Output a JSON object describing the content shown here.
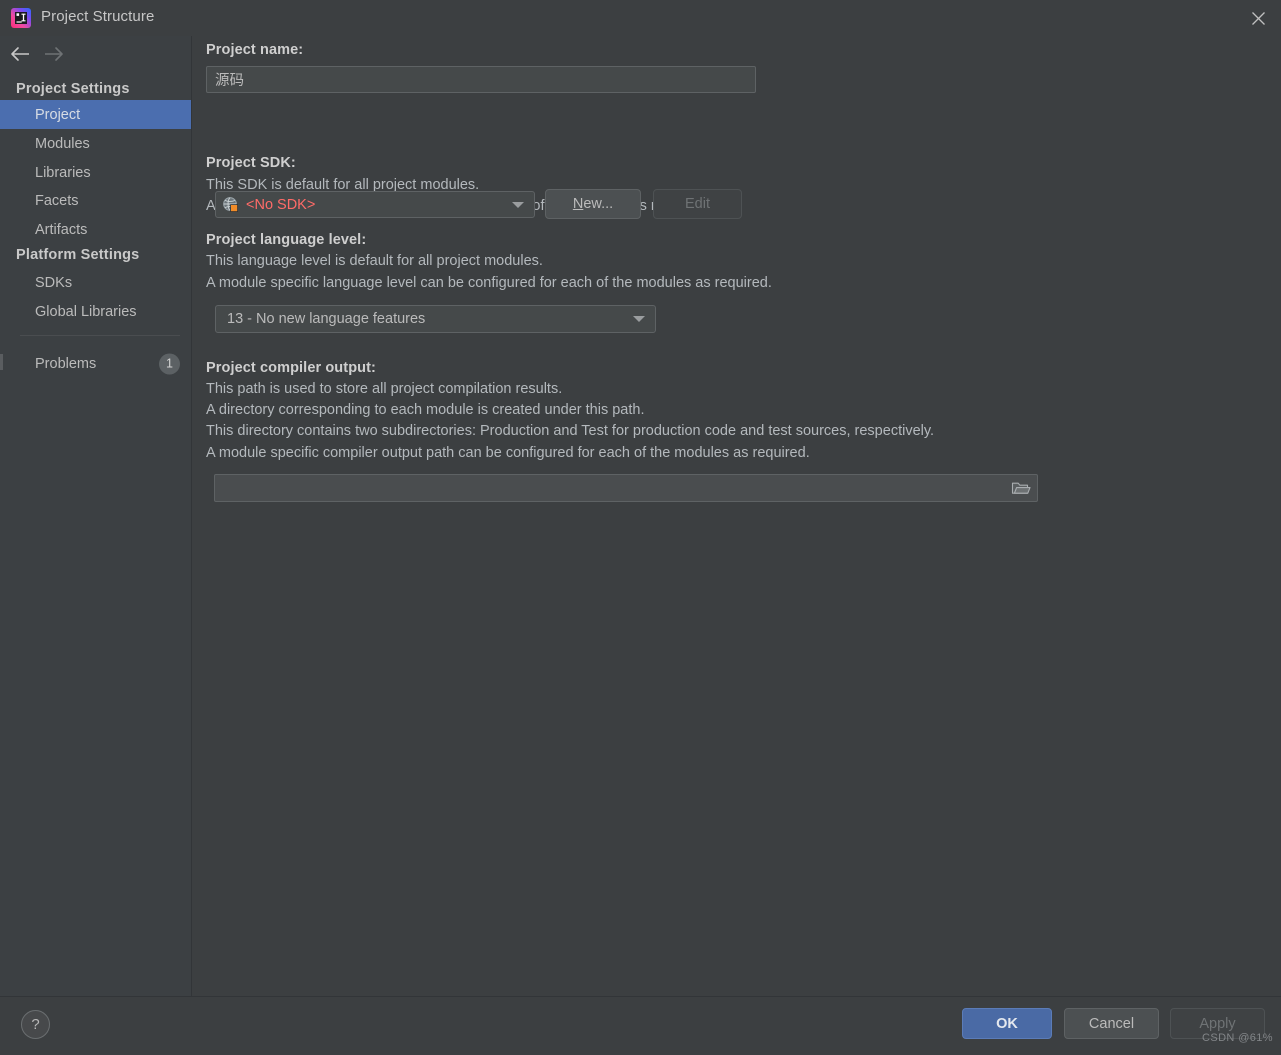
{
  "window": {
    "title": "Project Structure",
    "logo_icon": "intellij-idea-logo",
    "close_icon": "close-icon"
  },
  "sidebar": {
    "nav": {
      "back_icon": "arrow-left-icon",
      "forward_icon": "arrow-right-icon"
    },
    "groups": [
      {
        "header": "Project Settings",
        "items": [
          {
            "label": "Project",
            "selected": true
          },
          {
            "label": "Modules",
            "selected": false
          },
          {
            "label": "Libraries",
            "selected": false
          },
          {
            "label": "Facets",
            "selected": false
          },
          {
            "label": "Artifacts",
            "selected": false
          }
        ]
      },
      {
        "header": "Platform Settings",
        "items": [
          {
            "label": "SDKs",
            "selected": false
          },
          {
            "label": "Global Libraries",
            "selected": false
          }
        ]
      }
    ],
    "problems": {
      "label": "Problems",
      "badge": "1"
    }
  },
  "main": {
    "project_name": {
      "label": "Project name:",
      "value": "源码"
    },
    "project_sdk": {
      "label": "Project SDK:",
      "desc_line1": "This SDK is default for all project modules.",
      "desc_line2": "A module specific SDK can be configured for each of the modules as required.",
      "combo_icon": "sdk-globe-warning-icon",
      "combo_value": "<No SDK>",
      "combo_value_color": "#ff6b68",
      "dropdown_icon": "chevron-down-icon",
      "new_button": "New...",
      "new_button_mnemonic": "N",
      "new_button_rest": "ew...",
      "edit_button": "Edit",
      "edit_button_enabled": false
    },
    "language_level": {
      "label": "Project language level:",
      "desc_line1": "This language level is default for all project modules.",
      "desc_line2": "A module specific language level can be configured for each of the modules as required.",
      "combo_value": "13 - No new language features",
      "dropdown_icon": "chevron-down-icon"
    },
    "compiler_output": {
      "label": "Project compiler output:",
      "desc_line1": "This path is used to store all project compilation results.",
      "desc_line2": "A directory corresponding to each module is created under this path.",
      "desc_line3": "This directory contains two subdirectories: Production and Test for production code and test sources, respectively.",
      "desc_line4": "A module specific compiler output path can be configured for each of the modules as required.",
      "value": "",
      "browse_icon": "folder-icon"
    }
  },
  "footer": {
    "help_label": "?",
    "help_icon": "help-icon",
    "ok": "OK",
    "cancel": "Cancel",
    "apply": "Apply",
    "apply_enabled": false
  },
  "watermark": "CSDN @61%",
  "colors": {
    "window_bg": "#3c3f41",
    "sidebar_bg": "#3c4043",
    "selection_blue": "#4b6eaf",
    "primary_button": "#4a6aa5",
    "error_red": "#ff6b68",
    "text": "#bbbbbb"
  }
}
